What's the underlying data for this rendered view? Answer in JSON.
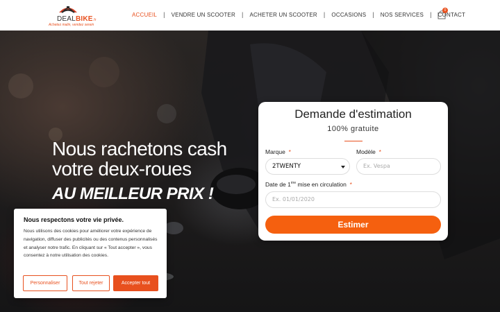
{
  "brand": {
    "name_part1": "DEAL",
    "name_part2": "BIKE",
    "name_suffix": ".fr",
    "tagline": "Achetez malin, vendez serein",
    "accent_color": "#e8501e"
  },
  "nav": {
    "items": [
      {
        "label": "ACCUEIL",
        "active": true
      },
      {
        "label": "VENDRE UN SCOOTER",
        "active": false
      },
      {
        "label": "ACHETER UN SCOOTER",
        "active": false
      },
      {
        "label": "OCCASIONS",
        "active": false
      },
      {
        "label": "NOS SERVICES",
        "active": false
      },
      {
        "label": "CONTACT",
        "active": false
      }
    ],
    "separator": "|",
    "cart_icon": "shopping-bag-icon",
    "cart_count": "0"
  },
  "hero": {
    "title_line1": "Nous rachetons cash",
    "title_line2": "votre deux-roues",
    "subtitle": "AU MEILLEUR PRIX !"
  },
  "estimate_form": {
    "title": "Demande d'estimation",
    "subtitle": "100% gratuite",
    "brand_label": "Marque",
    "brand_value": "2TWENTY",
    "model_label": "Modèle",
    "model_placeholder": "Ex. Vespa",
    "date_label_before": "Date de 1",
    "date_label_sup": "ère",
    "date_label_after": " mise en circulation",
    "date_placeholder": "Ex. 01/01/2020",
    "required_mark": "*",
    "submit_label": "Estimer"
  },
  "cookie_banner": {
    "title": "Nous respectons votre vie privée.",
    "text": "Nous utilisons des cookies pour améliorer votre expérience de navigation, diffuser des publicités ou des contenus personnalisés et analyser notre trafic. En cliquant sur « Tout accepter », vous consentez à notre utilisation des cookies.",
    "customize_label": "Personnaliser",
    "reject_label": "Tout rejeter",
    "accept_label": "Accepter tout"
  }
}
